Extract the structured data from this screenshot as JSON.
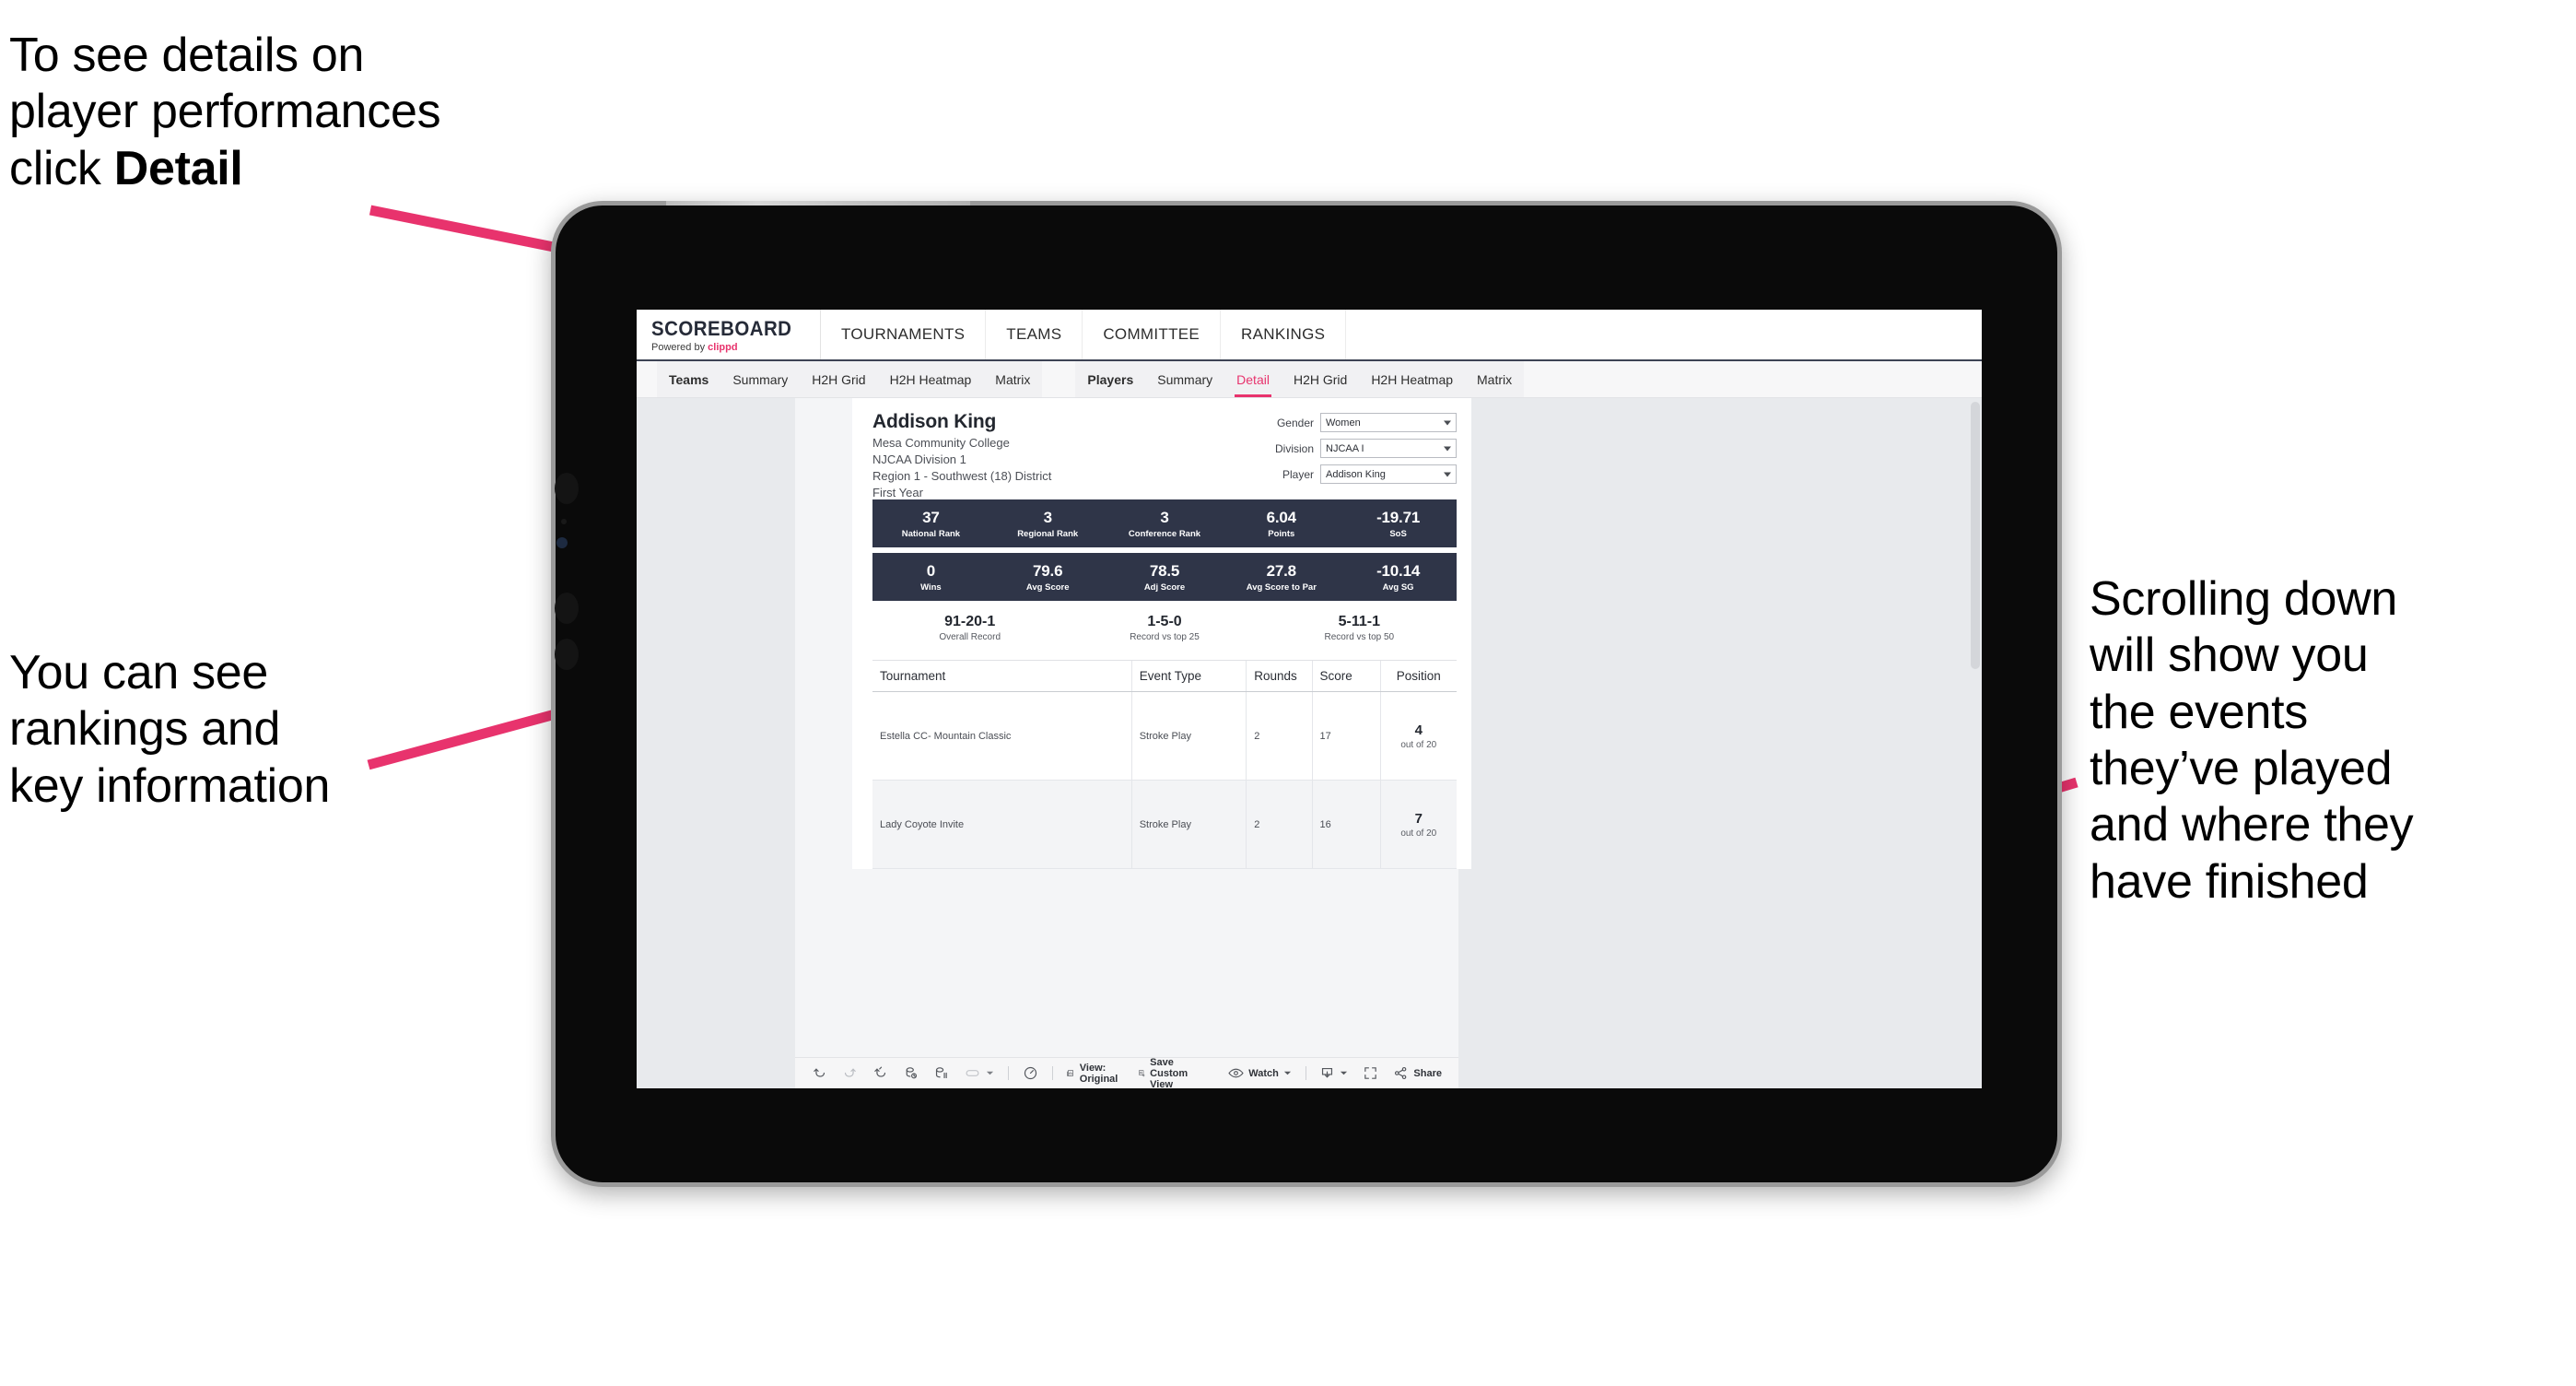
{
  "annotations": {
    "detail": "To see details on\nplayer performances\nclick ",
    "detail_bold": "Detail",
    "rankings": "You can see\nrankings and\nkey information",
    "scrolling": "Scrolling down\nwill show you\nthe events\nthey’ve played\nand where they\nhave finished"
  },
  "colors": {
    "accent_pink": "#e8336d",
    "band_navy": "#2f3548",
    "screen_bg": "#e8eaed"
  },
  "app": {
    "brand": {
      "title": "SCOREBOARD",
      "powered_prefix": "Powered by ",
      "powered_name": "clippd"
    },
    "top_nav": [
      "TOURNAMENTS",
      "TEAMS",
      "COMMITTEE",
      "RANKINGS"
    ],
    "teams_tabs": {
      "head": "Teams",
      "items": [
        "Summary",
        "H2H Grid",
        "H2H Heatmap",
        "Matrix"
      ]
    },
    "players_tabs": {
      "head": "Players",
      "items": [
        "Summary",
        "Detail",
        "H2H Grid",
        "H2H Heatmap",
        "Matrix"
      ],
      "active": "Detail"
    }
  },
  "player": {
    "name": "Addison King",
    "school": "Mesa Community College",
    "division": "NJCAA Division 1",
    "region": "Region 1 - Southwest (18) District",
    "year": "First Year"
  },
  "filters": [
    {
      "label": "Gender",
      "value": "Women"
    },
    {
      "label": "Division",
      "value": "NJCAA I"
    },
    {
      "label": "Player",
      "value": "Addison King"
    }
  ],
  "stats_row1": [
    {
      "value": "37",
      "label": "National Rank"
    },
    {
      "value": "3",
      "label": "Regional Rank"
    },
    {
      "value": "3",
      "label": "Conference Rank"
    },
    {
      "value": "6.04",
      "label": "Points"
    },
    {
      "value": "-19.71",
      "label": "SoS"
    }
  ],
  "stats_row2": [
    {
      "value": "0",
      "label": "Wins"
    },
    {
      "value": "79.6",
      "label": "Avg Score"
    },
    {
      "value": "78.5",
      "label": "Adj Score"
    },
    {
      "value": "27.8",
      "label": "Avg Score to Par"
    },
    {
      "value": "-10.14",
      "label": "Avg SG"
    }
  ],
  "records": [
    {
      "value": "91-20-1",
      "label": "Overall Record"
    },
    {
      "value": "1-5-0",
      "label": "Record vs top 25"
    },
    {
      "value": "5-11-1",
      "label": "Record vs top 50"
    }
  ],
  "table": {
    "headers": [
      "Tournament",
      "Event Type",
      "Rounds",
      "Score",
      "Position"
    ],
    "rows": [
      {
        "tournament": "Estella CC- Mountain Classic",
        "event_type": "Stroke Play",
        "rounds": "2",
        "score": "17",
        "position": "4",
        "position_out_of": "out of 20"
      },
      {
        "tournament": "Lady Coyote Invite",
        "event_type": "Stroke Play",
        "rounds": "2",
        "score": "16",
        "position": "7",
        "position_out_of": "out of 20"
      }
    ]
  },
  "toolbar": {
    "view_label": "View: Original",
    "save_label": "Save Custom View",
    "watch_label": "Watch",
    "share_label": "Share"
  }
}
